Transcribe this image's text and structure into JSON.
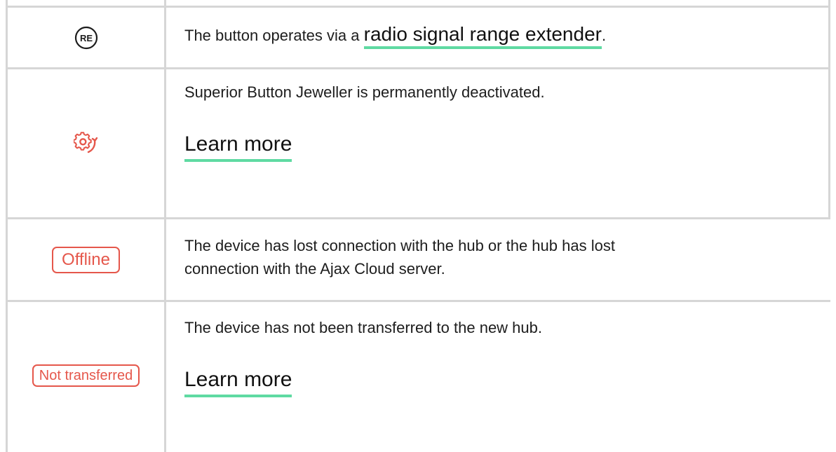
{
  "rows": [
    {
      "icon": "re-icon",
      "icon_text": "RE",
      "text_before": "The button operates via a ",
      "link": "radio signal range extender",
      "text_after": "."
    },
    {
      "icon": "gear-refresh-icon",
      "text": "Superior Button Jeweller is permanently deactivated.",
      "link": "Learn more"
    },
    {
      "badge": "Offline",
      "text": "The device has lost connection with the hub or the hub has lost connection with the Ajax Cloud server."
    },
    {
      "badge": "Not transferred",
      "text": "The device has not been transferred to the new hub.",
      "link": "Learn more"
    }
  ],
  "colors": {
    "accent_underline": "#5fdaa2",
    "status_red": "#e5574b",
    "border": "#d6d6d6"
  }
}
